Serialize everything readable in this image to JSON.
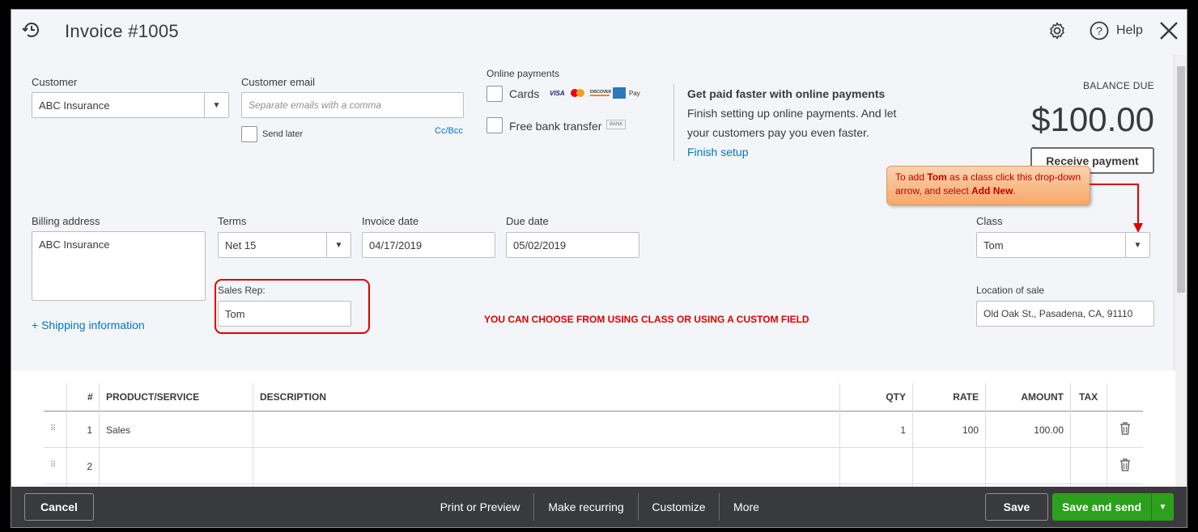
{
  "header": {
    "title": "Invoice #1005",
    "help_label": "Help"
  },
  "customer": {
    "label": "Customer",
    "value": "ABC Insurance"
  },
  "customer_email": {
    "label": "Customer email",
    "placeholder": "Separate emails with a comma",
    "send_later_label": "Send later",
    "cc_bcc_label": "Cc/Bcc"
  },
  "online_payments": {
    "label": "Online payments",
    "cards_label": "Cards",
    "card_brands": [
      "VISA",
      "mastercard",
      "DISCOVER",
      "AMEX",
      "Pay"
    ],
    "bank_label": "Free bank transfer",
    "bank_badge": "BANK",
    "promo_title": "Get paid faster with online payments",
    "promo_line1": "Finish setting up online payments. And let",
    "promo_line2": "your customers pay you even faster.",
    "finish_setup": "Finish setup"
  },
  "balance": {
    "label": "BALANCE DUE",
    "amount": "$100.00",
    "receive_payment": "Receive payment"
  },
  "billing": {
    "label": "Billing address",
    "value": "ABC Insurance",
    "shipping_link": "+ Shipping information"
  },
  "terms": {
    "label": "Terms",
    "value": "Net 15"
  },
  "invoice_date": {
    "label": "Invoice date",
    "value": "04/17/2019"
  },
  "due_date": {
    "label": "Due date",
    "value": "05/02/2019"
  },
  "sales_rep": {
    "label": "Sales Rep:",
    "value": "Tom"
  },
  "class_field": {
    "label": "Class",
    "value": "Tom"
  },
  "location": {
    "label": "Location of sale",
    "value": "Old Oak St., Pasadena, CA, 91110"
  },
  "annotations": {
    "callout_pre": "To add ",
    "callout_bold1": "Tom",
    "callout_mid": " as a class click this drop-down arrow, and select ",
    "callout_bold2": "Add New",
    "callout_end": ".",
    "note": "YOU CAN CHOOSE FROM USING CLASS OR USING A CUSTOM FIELD"
  },
  "table": {
    "headers": {
      "num": "#",
      "product": "PRODUCT/SERVICE",
      "description": "DESCRIPTION",
      "qty": "QTY",
      "rate": "RATE",
      "amount": "AMOUNT",
      "tax": "TAX"
    },
    "rows": [
      {
        "num": "1",
        "product": "Sales",
        "description": "",
        "qty": "1",
        "rate": "100",
        "amount": "100.00"
      },
      {
        "num": "2",
        "product": "",
        "description": "",
        "qty": "",
        "rate": "",
        "amount": ""
      }
    ]
  },
  "footer": {
    "cancel": "Cancel",
    "print_preview": "Print or Preview",
    "make_recurring": "Make recurring",
    "customize": "Customize",
    "more": "More",
    "save": "Save",
    "save_and_send": "Save and send"
  },
  "colors": {
    "accent_green": "#2ca01c",
    "link_blue": "#0077c5",
    "footer_bg": "#393a3d",
    "annotation_red": "#e00000"
  }
}
